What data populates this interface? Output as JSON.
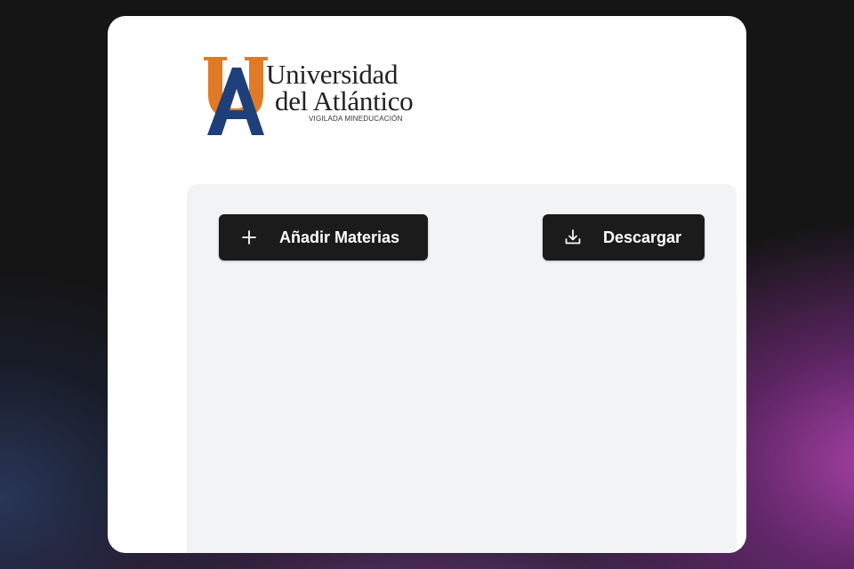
{
  "logo": {
    "line1": "Universidad",
    "line2": "del Atlántico",
    "tagline": "VIGILADA MINEDUCACIÓN"
  },
  "actions": {
    "add_subjects": {
      "label": "Añadir Materias",
      "icon": "plus-icon"
    },
    "download": {
      "label": "Descargar",
      "icon": "download-icon"
    }
  },
  "colors": {
    "logo_orange": "#e07a26",
    "logo_navy": "#1f3f7a",
    "button_bg": "#1b1b1c",
    "panel_bg": "#f1f3f5"
  }
}
